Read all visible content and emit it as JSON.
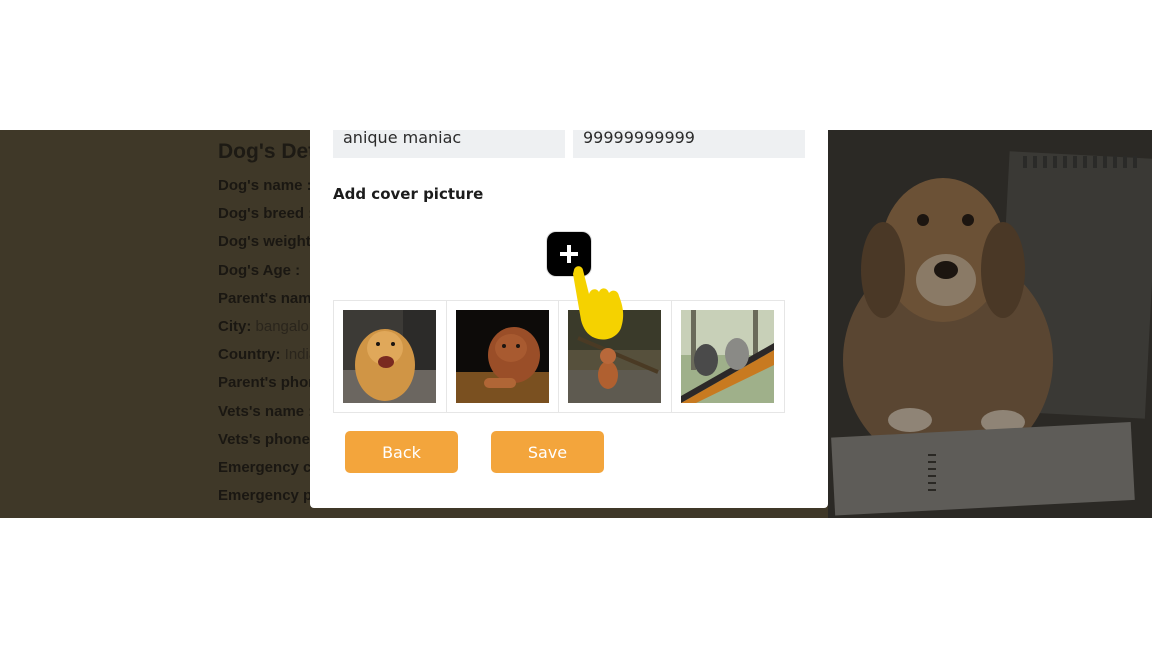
{
  "background": {
    "details_title": "Dog's Details",
    "details_rows": [
      {
        "label": "Dog's name :",
        "value": ""
      },
      {
        "label": "Dog's breed :",
        "value": ""
      },
      {
        "label": "Dog's weight :",
        "value": ""
      },
      {
        "label": "Dog's Age :",
        "value": ""
      },
      {
        "label": "Parent's name :",
        "value": ""
      },
      {
        "label": "City:",
        "value": " bangalore"
      },
      {
        "label": "Country:",
        "value": " India"
      },
      {
        "label": "Parent's phone :",
        "value": ""
      },
      {
        "label": "Vets's name :",
        "value": ""
      },
      {
        "label": "Vets's phone :",
        "value": ""
      },
      {
        "label": "Emergency contact :",
        "value": ""
      },
      {
        "label": "Emergency phone :",
        "value": ""
      }
    ]
  },
  "modal": {
    "name_value": "anique maniac",
    "phone_value": "99999999999",
    "cover_label": "Add cover picture",
    "add_icon": "plus-icon",
    "thumbnails": [
      {
        "name": "golden-retriever-photo"
      },
      {
        "name": "mastiff-puppy-photo"
      },
      {
        "name": "dog-with-stick-photo"
      },
      {
        "name": "dogs-in-hammock-photo"
      }
    ],
    "back_label": "Back",
    "save_label": "Save"
  },
  "colors": {
    "overlay": "#3f3828",
    "button": "#f3a53c",
    "field_bg": "#eef0f2",
    "pointer": "#f5d200"
  },
  "pointer_icon": "hand-pointer-icon"
}
